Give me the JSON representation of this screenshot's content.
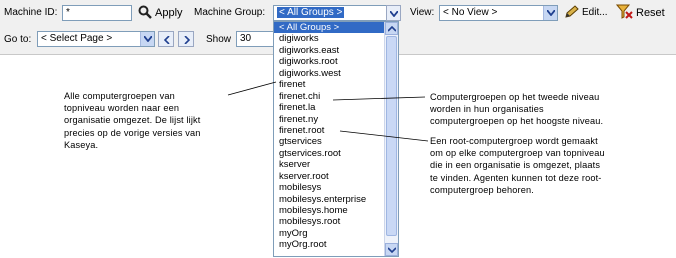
{
  "toolbar": {
    "machine_id_label": "Machine ID:",
    "machine_id_value": "*",
    "apply_label": "Apply",
    "machine_group_label": "Machine Group:",
    "machine_group_value": "< All Groups >",
    "view_label": "View:",
    "view_value": "< No View >",
    "edit_label": "Edit...",
    "reset_label": "Reset",
    "goto_label": "Go to:",
    "goto_value": "< Select Page >",
    "show_label": "Show",
    "show_value": "30"
  },
  "group_list": [
    "< All Groups >",
    "digiworks",
    "digiworks.east",
    "digiworks.root",
    "digiworks.west",
    "firenet",
    "firenet.chi",
    "firenet.la",
    "firenet.ny",
    "firenet.root",
    "gtservices",
    "gtservices.root",
    "kserver",
    "kserver.root",
    "mobilesys",
    "mobilesys.enterprise",
    "mobilesys.home",
    "mobilesys.root",
    "myOrg",
    "myOrg.root"
  ],
  "annotations": {
    "left": [
      "Alle computergroepen van",
      "topniveau worden naar een",
      "organisatie omgezet. De lijst lijkt",
      "precies op de vorige versies van",
      "Kaseya."
    ],
    "right_top": [
      "Computergroepen op het tweede niveau",
      "worden in hun organisaties",
      "computergroepen op het hoogste niveau."
    ],
    "right_bottom": [
      "Een root-computergroep wordt gemaakt",
      "om op elke computergroep van topniveau",
      "die in een organisatie is omgezet, plaats",
      "te vinden. Agenten kunnen tot deze root-",
      "computergroep behoren."
    ]
  },
  "colors": {
    "selection": "#316ac5",
    "toolbar_bg": "#f0f0f0",
    "field_border": "#7f9db9"
  }
}
